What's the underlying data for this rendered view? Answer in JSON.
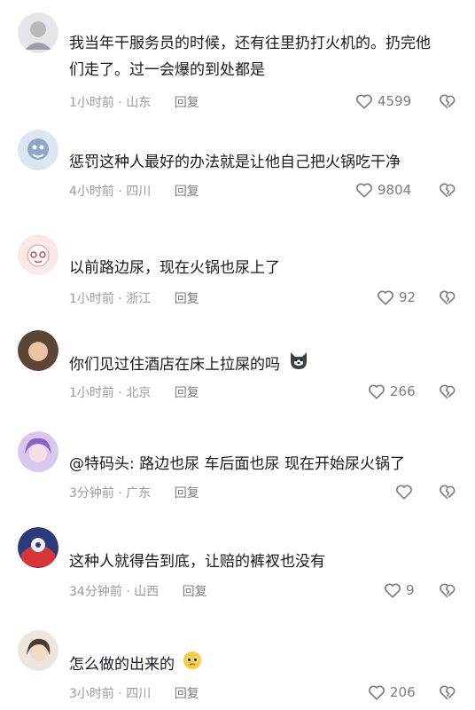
{
  "comments": [
    {
      "username": "",
      "text_lines": [
        "我当年干服务员的时候，还有往里扔打火机的。扔完他",
        "们走了。过一会爆的到处都是"
      ],
      "time_location": "1小时前 · 山东",
      "reply_label": "回复",
      "likes": "4599",
      "avatar_color": "#cfcfd4"
    },
    {
      "username": "",
      "text_lines": [
        "惩罚这种人最好的办法就是让他自己把火锅吃干净"
      ],
      "time_location": "4小时前 · 四川",
      "reply_label": "回复",
      "likes": "9804",
      "avatar_color": "#8fa7c7"
    },
    {
      "username": "",
      "text_lines": [
        "以前路边尿，现在火锅也尿上了"
      ],
      "time_location": "1小时前 · 浙江",
      "reply_label": "回复",
      "likes": "92",
      "avatar_color": "#f3d2d2"
    },
    {
      "username": "",
      "text_lines": [
        "你们见过住酒店在床上拉屎的吗"
      ],
      "time_location": "1小时前 · 北京",
      "reply_label": "回复",
      "likes": "266",
      "avatar_color": "#7a5c48",
      "emoji": "dog-face-icon"
    },
    {
      "username": "",
      "text_lines": [
        "@特码头: 路边也尿 车后面也尿 现在开始尿火锅了"
      ],
      "time_location": "3分钟前 · 广东",
      "reply_label": "回复",
      "likes": "",
      "avatar_color": "#b59ad8"
    },
    {
      "username": "",
      "text_lines": [
        "这种人就得告到底，让赔的裤衩也没有"
      ],
      "time_location": "34分钟前 · 山西",
      "reply_label": "回复",
      "likes": "9",
      "avatar_color": "#3d4f8f"
    },
    {
      "username": "",
      "text_lines": [
        "怎么做的出来的"
      ],
      "time_location": "3小时前 · 四川",
      "reply_label": "回复",
      "likes": "206",
      "avatar_color": "#d9cfc6",
      "emoji": "pleading-face-icon"
    }
  ]
}
